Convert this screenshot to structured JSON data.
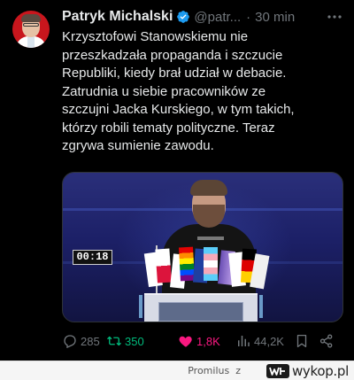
{
  "tweet": {
    "author_name": "Patryk Michalski",
    "handle": "@patr...",
    "separator": "·",
    "time": "30 min",
    "text": "Krzysztofowi Stanowskiemu nie\nprzeszkadzała propaganda i szczucie\nRepubliki, kiedy brał udział w debacie.\nZatrudnia u siebie pracowników ze\nszczujni Jacka Kurskiego, w tym takich,\nktórzy robili tematy polityczne. Teraz\nzgrywa sumienie zawodu.",
    "video_timer": "00:18"
  },
  "actions": {
    "replies": "285",
    "retweets": "350",
    "likes": "1,8K",
    "views": "44,2K"
  },
  "footer": {
    "attribution": "Promilus",
    "separator": "z",
    "site_logo_text": "wykop.pl"
  },
  "icons": {
    "verified": "verified-badge-icon",
    "more": "more-icon",
    "reply": "reply-icon",
    "retweet": "retweet-icon",
    "like": "heart-icon",
    "views": "views-icon",
    "bookmark": "bookmark-icon",
    "share": "share-icon"
  },
  "colors": {
    "background": "#000000",
    "text": "#e7e9ea",
    "muted": "#71767b",
    "verified": "#1d9bf0",
    "retweet": "#00ba7c",
    "like": "#f91880"
  }
}
